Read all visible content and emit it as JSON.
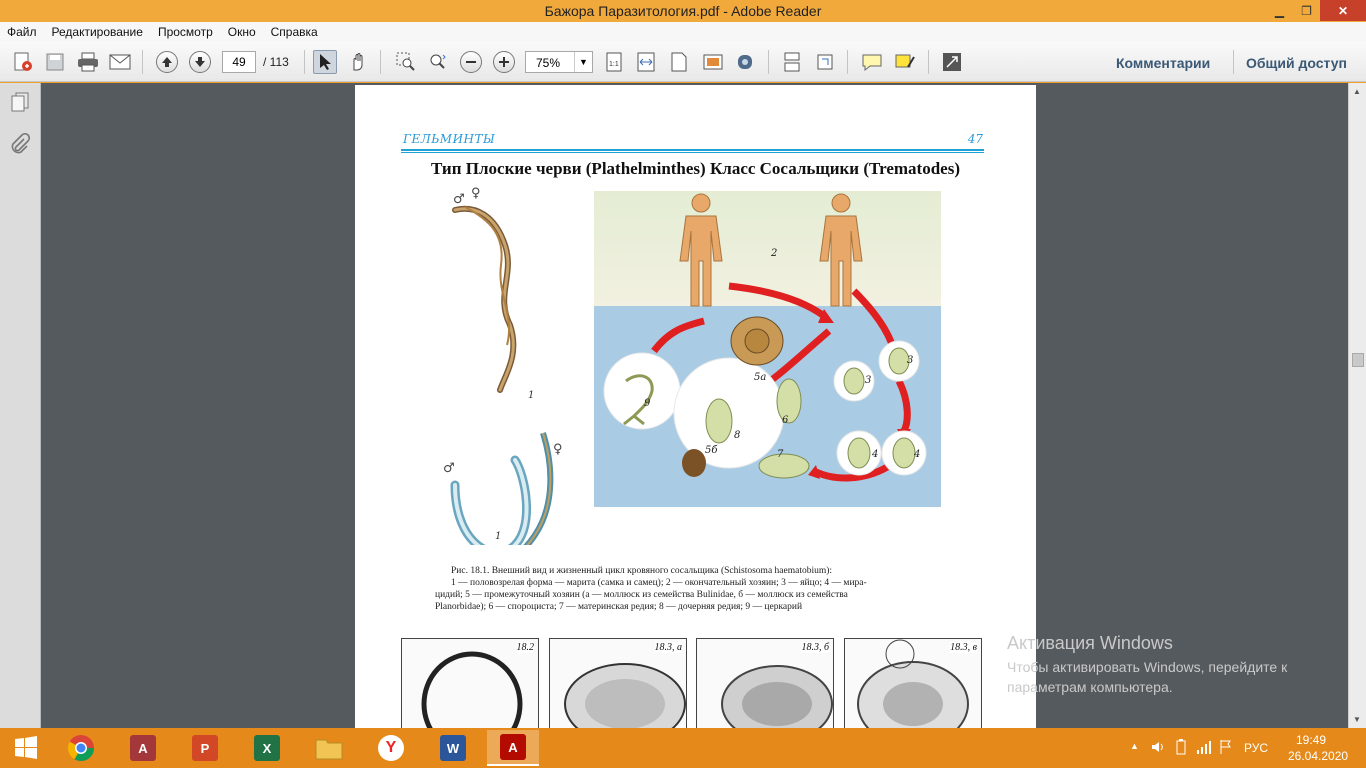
{
  "window": {
    "title": "Бажора Паразитология.pdf - Adobe Reader"
  },
  "menu": [
    "Файл",
    "Редактирование",
    "Просмотр",
    "Окно",
    "Справка"
  ],
  "toolbar": {
    "page_current": "49",
    "page_total": "/ 113",
    "zoom": "75%",
    "comments_label": "Комментарии",
    "share_label": "Общий доступ"
  },
  "page": {
    "header_left": "ГЕЛЬМИНТЫ",
    "header_right": "47",
    "heading": "Тип Плоские черви (Plathelminthes) Класс Сосальщики (Trematodes)",
    "figure_labels": [
      "1",
      "1",
      "2",
      "3",
      "3",
      "4",
      "4",
      "5a",
      "5б",
      "6",
      "7",
      "8",
      "9"
    ],
    "caption_line1": "Рис. 18.1. Внешний вид и жизненный цикл кровяного сосальщика (Schistosoma haematobium):",
    "caption_line2": "1 — половозрелая форма — марита (самка и самец); 2 — окончательный хозяин; 3 — яйцо; 4 — мира-",
    "caption_line3": "цидий; 5 — промежуточный хозяин (а — моллюск из семейства Bulinidae, б — моллюск из семейства",
    "caption_line4": "Planorbidae); 6 — спороциста; 7 — материнская редия; 8 — дочерняя редия; 9 — церкарий",
    "thumbnails": [
      "18.2",
      "18.3, а",
      "18.3, б",
      "18.3, в"
    ]
  },
  "watermark": {
    "title": "Активация Windows",
    "line1": "Чтобы активировать Windows, перейдите к",
    "line2": "параметрам компьютера."
  },
  "taskbar": {
    "language": "РУС",
    "time": "19:49",
    "date": "26.04.2020"
  },
  "colors": {
    "title_bar": "#f2a93b",
    "taskbar": "#e58a1a",
    "doc_background": "#555a5e",
    "accent_blue": "#1fa2d8",
    "close_button": "#c7402a"
  }
}
